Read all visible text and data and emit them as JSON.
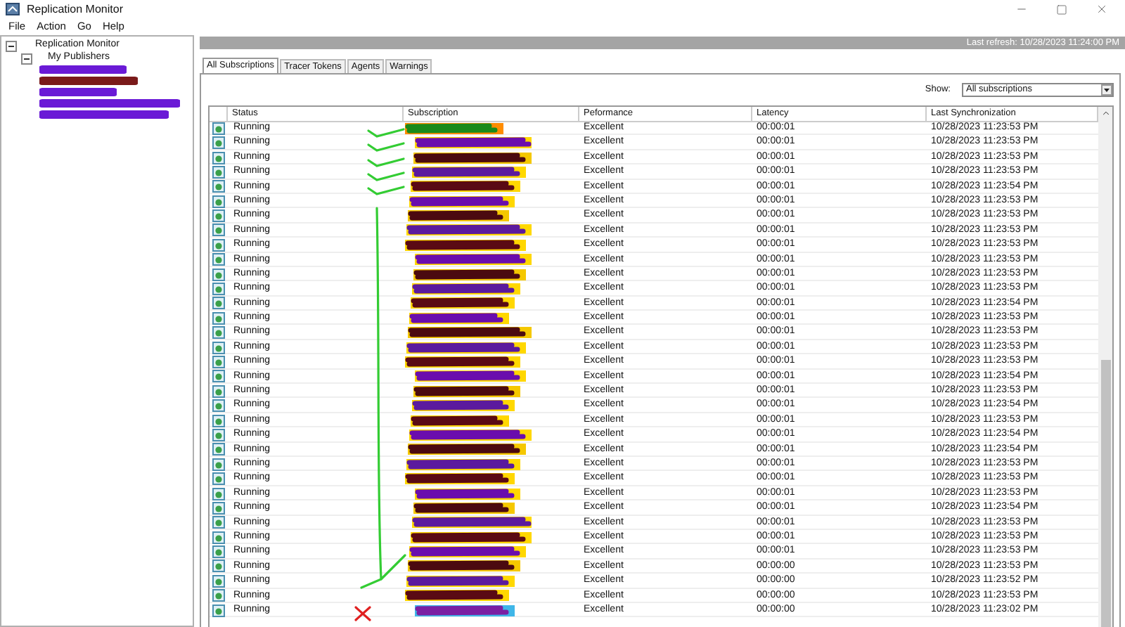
{
  "window": {
    "title": "Replication Monitor"
  },
  "menu": [
    "File",
    "Action",
    "Go",
    "Help"
  ],
  "tree": {
    "label": "Replication Monitor",
    "expanded": true,
    "children": [
      {
        "label": "My Publishers",
        "expanded": true
      }
    ]
  },
  "header_bar": {
    "text": "Last refresh: 10/28/2023 11:24:00 PM"
  },
  "tabs": [
    {
      "label": "All Subscriptions",
      "selected": true
    },
    {
      "label": "Tracer Tokens",
      "selected": false
    },
    {
      "label": "Agents",
      "selected": false
    },
    {
      "label": "Warnings",
      "selected": false
    }
  ],
  "show": {
    "label": "Show:",
    "value": "All subscriptions"
  },
  "table": {
    "columns": [
      "Status",
      "Subscription",
      "Peformance",
      "Latency",
      "Last Synchronization"
    ],
    "rows": [
      {
        "status": "Running",
        "performance": "Excellent",
        "latency": "00:00:01",
        "last_sync": "10/28/2023 11:23:53 PM"
      },
      {
        "status": "Running",
        "performance": "Excellent",
        "latency": "00:00:01",
        "last_sync": "10/28/2023 11:23:53 PM"
      },
      {
        "status": "Running",
        "performance": "Excellent",
        "latency": "00:00:01",
        "last_sync": "10/28/2023 11:23:53 PM"
      },
      {
        "status": "Running",
        "performance": "Excellent",
        "latency": "00:00:01",
        "last_sync": "10/28/2023 11:23:53 PM"
      },
      {
        "status": "Running",
        "performance": "Excellent",
        "latency": "00:00:01",
        "last_sync": "10/28/2023 11:23:54 PM"
      },
      {
        "status": "Running",
        "performance": "Excellent",
        "latency": "00:00:01",
        "last_sync": "10/28/2023 11:23:53 PM"
      },
      {
        "status": "Running",
        "performance": "Excellent",
        "latency": "00:00:01",
        "last_sync": "10/28/2023 11:23:53 PM"
      },
      {
        "status": "Running",
        "performance": "Excellent",
        "latency": "00:00:01",
        "last_sync": "10/28/2023 11:23:53 PM"
      },
      {
        "status": "Running",
        "performance": "Excellent",
        "latency": "00:00:01",
        "last_sync": "10/28/2023 11:23:53 PM"
      },
      {
        "status": "Running",
        "performance": "Excellent",
        "latency": "00:00:01",
        "last_sync": "10/28/2023 11:23:53 PM"
      },
      {
        "status": "Running",
        "performance": "Excellent",
        "latency": "00:00:01",
        "last_sync": "10/28/2023 11:23:53 PM"
      },
      {
        "status": "Running",
        "performance": "Excellent",
        "latency": "00:00:01",
        "last_sync": "10/28/2023 11:23:53 PM"
      },
      {
        "status": "Running",
        "performance": "Excellent",
        "latency": "00:00:01",
        "last_sync": "10/28/2023 11:23:54 PM"
      },
      {
        "status": "Running",
        "performance": "Excellent",
        "latency": "00:00:01",
        "last_sync": "10/28/2023 11:23:53 PM"
      },
      {
        "status": "Running",
        "performance": "Excellent",
        "latency": "00:00:01",
        "last_sync": "10/28/2023 11:23:53 PM"
      },
      {
        "status": "Running",
        "performance": "Excellent",
        "latency": "00:00:01",
        "last_sync": "10/28/2023 11:23:53 PM"
      },
      {
        "status": "Running",
        "performance": "Excellent",
        "latency": "00:00:01",
        "last_sync": "10/28/2023 11:23:53 PM"
      },
      {
        "status": "Running",
        "performance": "Excellent",
        "latency": "00:00:01",
        "last_sync": "10/28/2023 11:23:54 PM"
      },
      {
        "status": "Running",
        "performance": "Excellent",
        "latency": "00:00:01",
        "last_sync": "10/28/2023 11:23:53 PM"
      },
      {
        "status": "Running",
        "performance": "Excellent",
        "latency": "00:00:01",
        "last_sync": "10/28/2023 11:23:54 PM"
      },
      {
        "status": "Running",
        "performance": "Excellent",
        "latency": "00:00:01",
        "last_sync": "10/28/2023 11:23:53 PM"
      },
      {
        "status": "Running",
        "performance": "Excellent",
        "latency": "00:00:01",
        "last_sync": "10/28/2023 11:23:54 PM"
      },
      {
        "status": "Running",
        "performance": "Excellent",
        "latency": "00:00:01",
        "last_sync": "10/28/2023 11:23:54 PM"
      },
      {
        "status": "Running",
        "performance": "Excellent",
        "latency": "00:00:01",
        "last_sync": "10/28/2023 11:23:53 PM"
      },
      {
        "status": "Running",
        "performance": "Excellent",
        "latency": "00:00:01",
        "last_sync": "10/28/2023 11:23:53 PM"
      },
      {
        "status": "Running",
        "performance": "Excellent",
        "latency": "00:00:01",
        "last_sync": "10/28/2023 11:23:53 PM"
      },
      {
        "status": "Running",
        "performance": "Excellent",
        "latency": "00:00:01",
        "last_sync": "10/28/2023 11:23:54 PM"
      },
      {
        "status": "Running",
        "performance": "Excellent",
        "latency": "00:00:01",
        "last_sync": "10/28/2023 11:23:53 PM"
      },
      {
        "status": "Running",
        "performance": "Excellent",
        "latency": "00:00:01",
        "last_sync": "10/28/2023 11:23:53 PM"
      },
      {
        "status": "Running",
        "performance": "Excellent",
        "latency": "00:00:01",
        "last_sync": "10/28/2023 11:23:53 PM"
      },
      {
        "status": "Running",
        "performance": "Excellent",
        "latency": "00:00:00",
        "last_sync": "10/28/2023 11:23:53 PM"
      },
      {
        "status": "Running",
        "performance": "Excellent",
        "latency": "00:00:00",
        "last_sync": "10/28/2023 11:23:52 PM"
      },
      {
        "status": "Running",
        "performance": "Excellent",
        "latency": "00:00:00",
        "last_sync": "10/28/2023 11:23:53 PM"
      },
      {
        "status": "Running",
        "performance": "Excellent",
        "latency": "00:00:00",
        "last_sync": "10/28/2023 11:23:02 PM"
      }
    ]
  }
}
